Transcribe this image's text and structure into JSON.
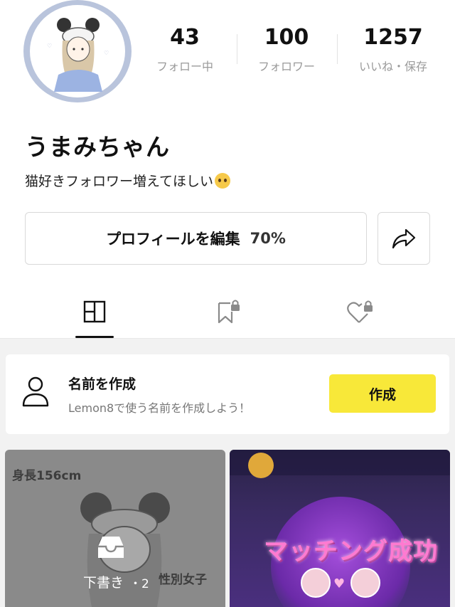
{
  "profile": {
    "username": "うまみちゃん",
    "bio": "猫好きフォロワー増えてほしい",
    "bio_emoji": "pleading-face-emoji"
  },
  "stats": [
    {
      "value": "43",
      "label": "フォロー中"
    },
    {
      "value": "100",
      "label": "フォロワー"
    },
    {
      "value": "1257",
      "label": "いいね・保存"
    }
  ],
  "actions": {
    "edit_label": "プロフィールを編集",
    "edit_progress": "70%",
    "share_icon": "share-arrow-icon"
  },
  "tabs": [
    {
      "name": "posts",
      "icon": "grid-icon",
      "active": true
    },
    {
      "name": "saved-locked",
      "icon": "bookmark-lock-icon",
      "active": false
    },
    {
      "name": "liked-locked",
      "icon": "heart-lock-icon",
      "active": false
    }
  ],
  "name_card": {
    "title": "名前を作成",
    "description": "Lemon8で使う名前を作成しよう！",
    "button_label": "作成",
    "button_color": "#f8e839"
  },
  "posts": [
    {
      "caption_top": "身長156cm",
      "caption_bottom": "性別女子",
      "draft_label": "下書き",
      "draft_count": "・2"
    },
    {
      "title": "マッチング成功",
      "title_color": "#ff7ad1"
    }
  ]
}
